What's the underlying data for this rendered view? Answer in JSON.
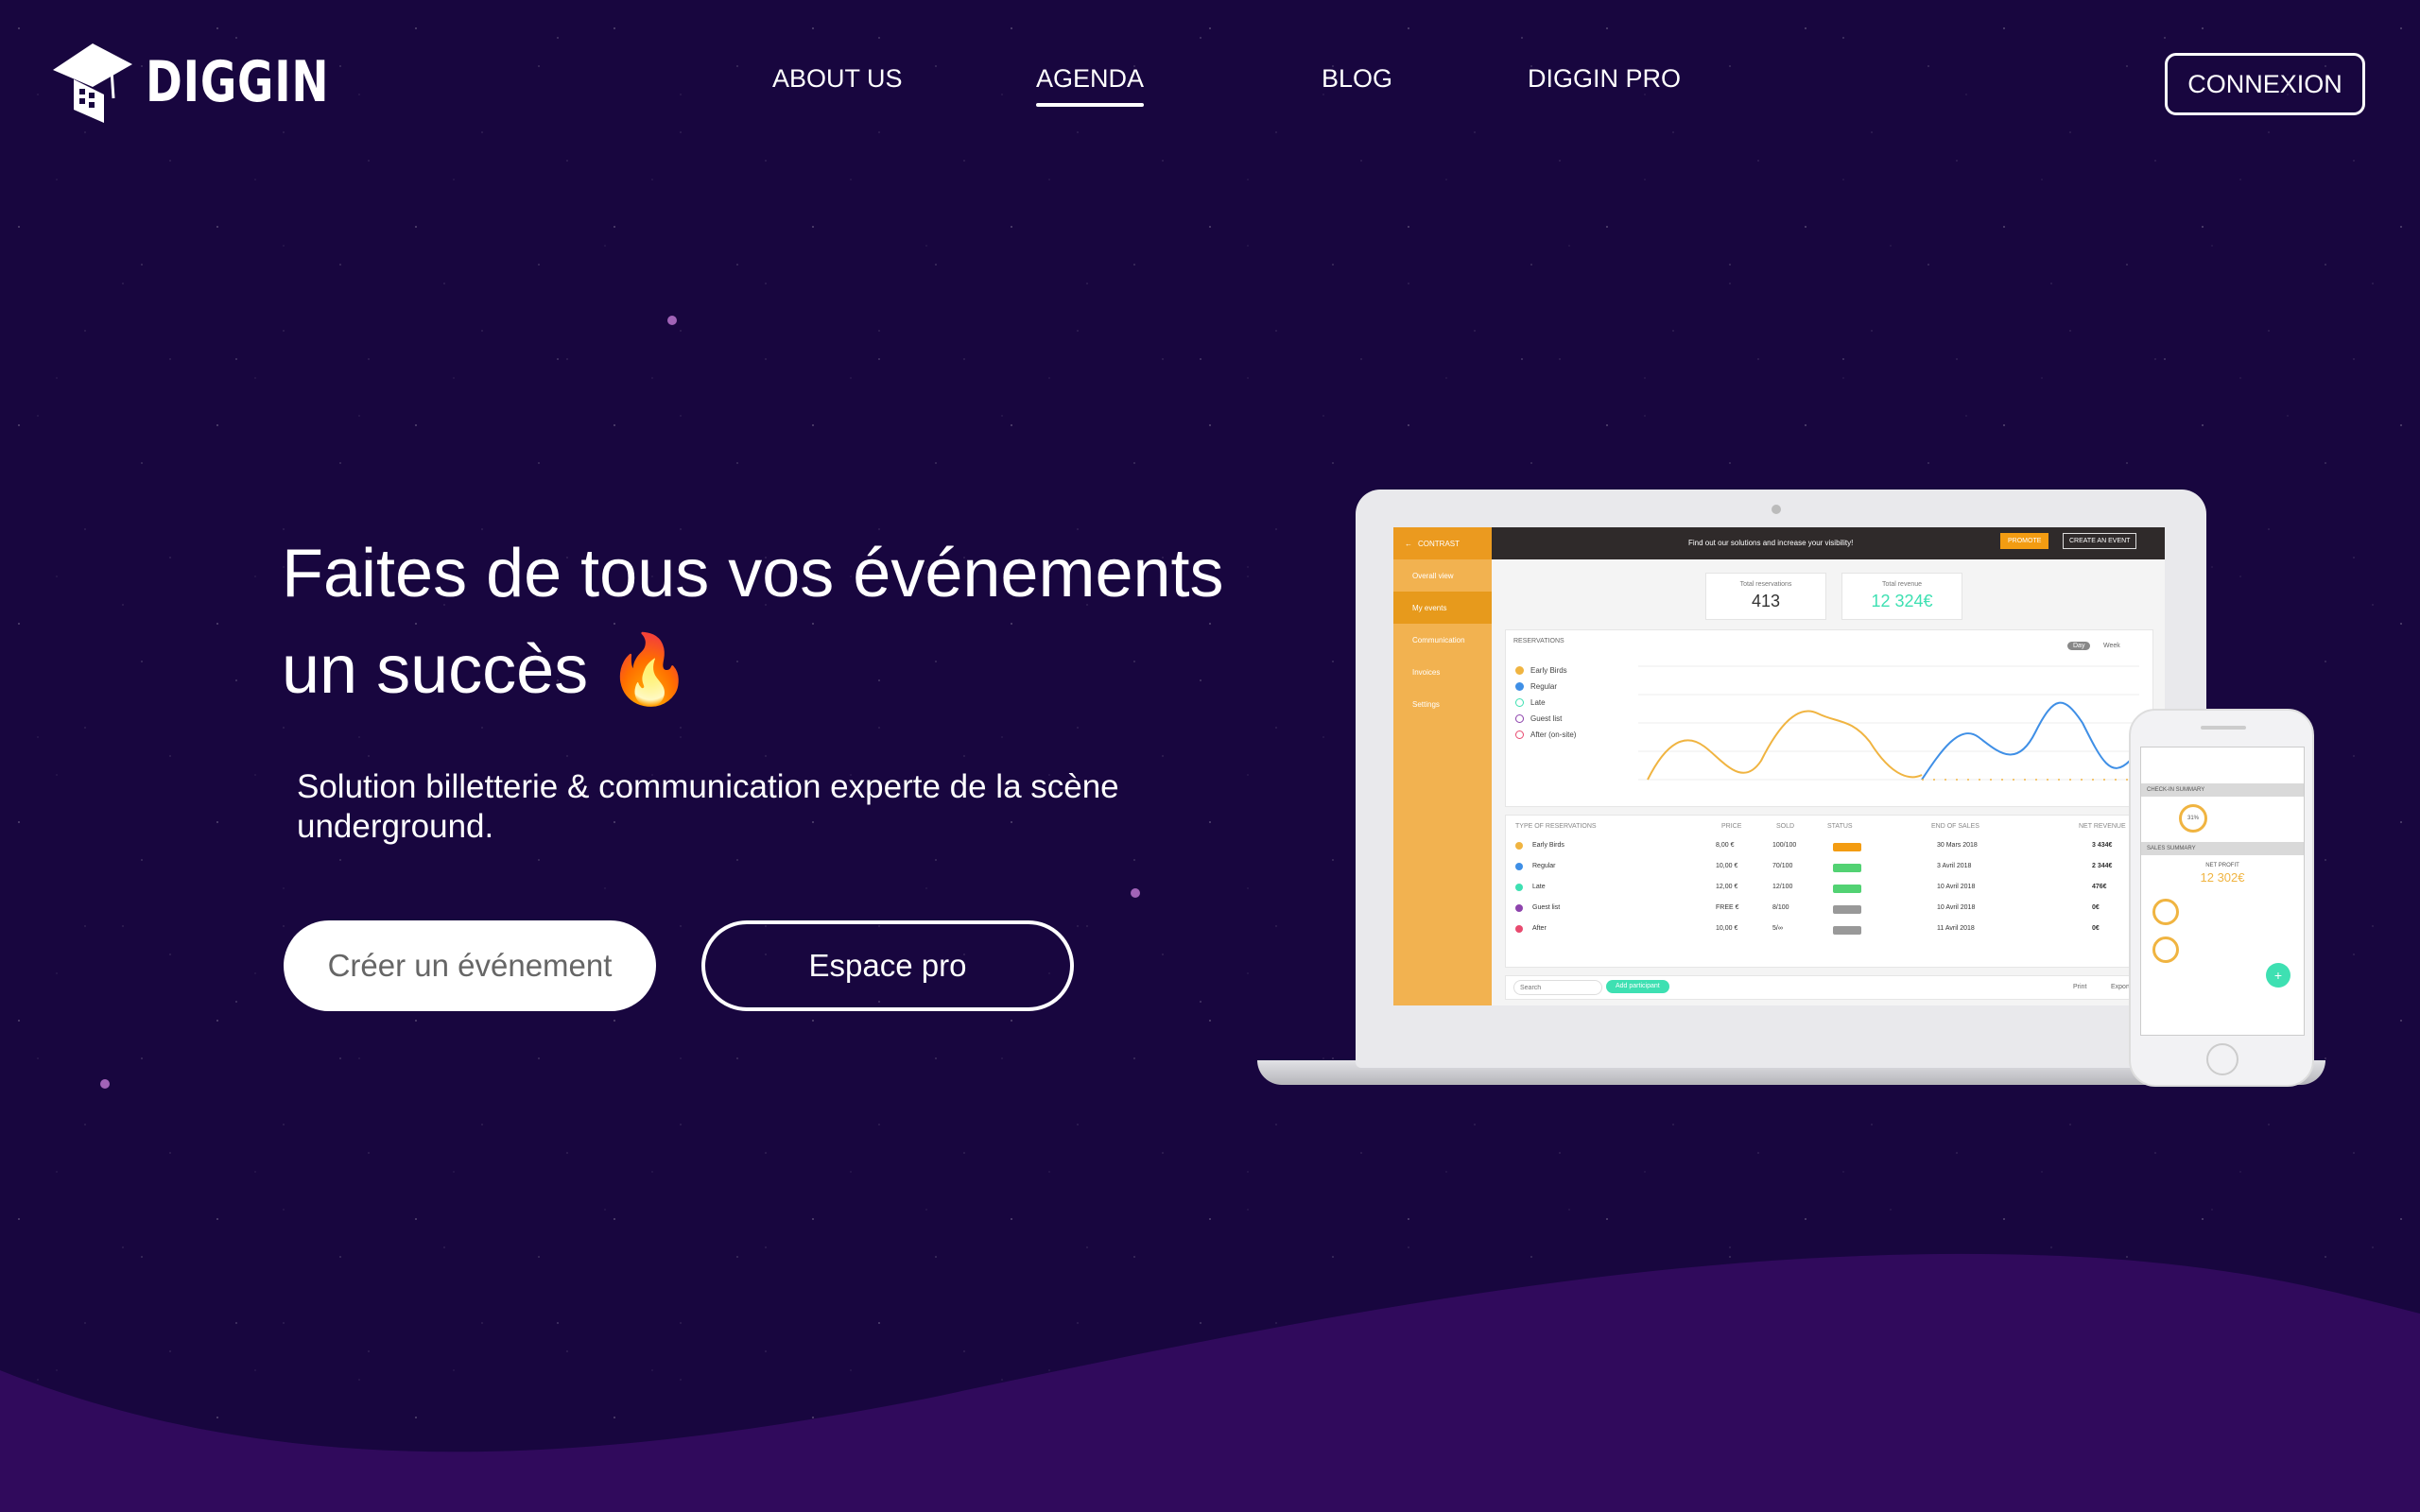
{
  "brand": {
    "name": "DIGGIN"
  },
  "nav": {
    "items": [
      {
        "label": "ABOUT US"
      },
      {
        "label": "AGENDA",
        "active": true
      },
      {
        "label": "BLOG"
      },
      {
        "label": "DIGGIN PRO"
      }
    ],
    "login_label": "CONNEXION"
  },
  "hero": {
    "title_line1": "Faites de tous vos événements",
    "title_line2": "un succès 🔥",
    "subtitle": "Solution billetterie & communication experte de la scène underground.",
    "cta_create": "Créer un événement",
    "cta_pro": "Espace pro"
  },
  "dashboard": {
    "sidebar_title": "CONTRAST",
    "sidebar_items": [
      "Overall view",
      "My events",
      "Communication",
      "Invoices",
      "Settings"
    ],
    "topbar_message": "Find out our solutions and increase your visibility!",
    "promote_label": "PROMOTE",
    "create_event_label": "CREATE AN EVENT",
    "stats": [
      {
        "label": "Total reservations",
        "value": "413"
      },
      {
        "label": "Total revenue",
        "value": "12 324€"
      }
    ],
    "chart_title": "RESERVATIONS",
    "toggle_day": "Day",
    "toggle_week": "Week",
    "legend": [
      {
        "label": "Early Birds"
      },
      {
        "label": "Regular"
      },
      {
        "label": "Late"
      },
      {
        "label": "Guest list"
      },
      {
        "label": "After (on-site)"
      }
    ],
    "table_headers": [
      "TYPE OF RESERVATIONS",
      "PRICE",
      "SOLD",
      "STATUS",
      "END OF SALES",
      "NET REVENUE"
    ],
    "table_rows": [
      {
        "type": "Early Birds",
        "price": "8,00 €",
        "sold": "100/100",
        "end": "30 Mars 2018",
        "revenue": "3 434€"
      },
      {
        "type": "Regular",
        "price": "10,00 €",
        "sold": "70/100",
        "end": "3 Avril 2018",
        "revenue": "2 344€"
      },
      {
        "type": "Late",
        "price": "12,00 €",
        "sold": "12/100",
        "end": "10 Avril 2018",
        "revenue": "476€"
      },
      {
        "type": "Guest list",
        "price": "FREE €",
        "sold": "8/100",
        "end": "10 Avril 2018",
        "revenue": "0€"
      },
      {
        "type": "After",
        "price": "10,00 €",
        "sold": "5/∞",
        "end": "11 Avril 2018",
        "revenue": "0€"
      }
    ],
    "search_placeholder": "Search",
    "add_participant_label": "Add participant",
    "print_label": "Print",
    "export_label": "Export"
  },
  "phone": {
    "checkin_title": "CHECK-IN SUMMARY",
    "checkin_pct": "31%",
    "sales_title": "SALES SUMMARY",
    "net_profit_label": "NET PROFIT",
    "net_profit_value": "12 302€"
  },
  "colors": {
    "background": "#18063f",
    "wave": "#300a5c",
    "dashboard_accent": "#f2b250",
    "chart_orange": "#f0b441",
    "chart_blue": "#3f8fe6",
    "teal": "#3ee0b2"
  }
}
